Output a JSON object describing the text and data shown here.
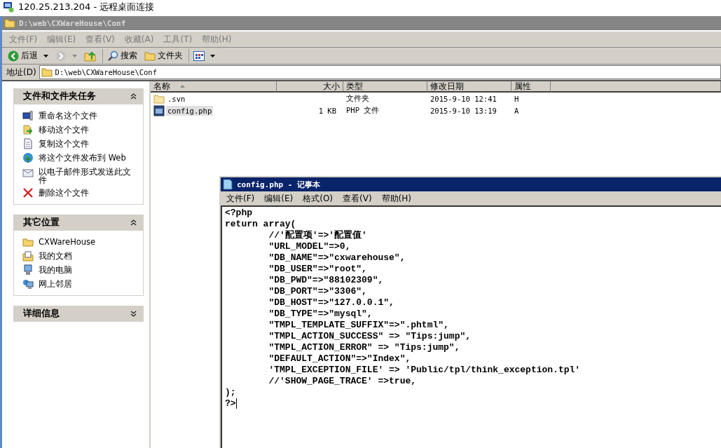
{
  "rdp_title": "120.25.213.204 - 远程桌面连接",
  "explorer": {
    "title": "D:\\web\\CXWareHouse\\Conf",
    "active": false,
    "menu": [
      "文件(F)",
      "编辑(E)",
      "查看(V)",
      "收藏(A)",
      "工具(T)",
      "帮助(H)"
    ],
    "toolbar": [
      {
        "kind": "back",
        "label": "后退",
        "disabled": false
      },
      {
        "kind": "forward",
        "disabled": true
      },
      {
        "kind": "up",
        "disabled": false
      },
      {
        "kind": "search",
        "label": "搜索",
        "disabled": false
      },
      {
        "kind": "folders",
        "label": "文件夹",
        "disabled": false
      },
      {
        "kind": "views",
        "disabled": false
      }
    ],
    "address_label": "地址(D)",
    "address": "D:\\web\\CXWareHouse\\Conf",
    "panels": [
      {
        "title": "文件和文件夹任务",
        "expanded": true,
        "items": [
          "重命名这个文件",
          "移动这个文件",
          "复制这个文件",
          "将这个文件发布到 Web",
          "以电子邮件形式发送此文件",
          "删除这个文件"
        ]
      },
      {
        "title": "其它位置",
        "expanded": true,
        "items": [
          "CXWareHouse",
          "我的文档",
          "我的电脑",
          "网上邻居"
        ]
      },
      {
        "title": "详细信息",
        "expanded": false
      }
    ],
    "columns": [
      "名称",
      "大小",
      "类型",
      "修改日期",
      "属性"
    ],
    "files": [
      {
        "kind": "folder",
        "name": ".svn",
        "type": "文件夹",
        "modified": "2015-9-10 12:41",
        "attr": "H",
        "selected": false
      },
      {
        "kind": "php",
        "name": "config.php",
        "size": "1 KB",
        "type": "PHP 文件",
        "modified": "2015-9-10 13:19",
        "attr": "A",
        "selected": true
      }
    ]
  },
  "notepad": {
    "title": "config.php - 记事本",
    "active": true,
    "menu": [
      "文件(F)",
      "编辑(E)",
      "格式(O)",
      "查看(V)",
      "帮助(H)"
    ],
    "lines": [
      "<?php",
      "return array(",
      "\t//'配置项'=>'配置值'",
      "\t\"URL_MODEL\"=>0,",
      "\t\"DB_NAME\"=>\"cxwarehouse\",",
      "\t\"DB_USER\"=>\"root\",",
      "\t\"DB_PWD\"=>\"88102309\",",
      "\t\"DB_PORT\"=>\"3306\",",
      "\t\"DB_HOST\"=>\"127.0.0.1\",",
      "\t\"DB_TYPE\"=>\"mysql\",",
      "\t\"TMPL_TEMPLATE_SUFFIX\"=>\".phtml\",",
      "\t\"TMPL_ACTION_SUCCESS\" => \"Tips:jump\",",
      "\t\"TMPL_ACTION_ERROR\" => \"Tips:jump\",",
      "\t\"DEFAULT_ACTION\"=>\"Index\",",
      "\t'TMPL_EXCEPTION_FILE' => 'Public/tpl/think_exception.tpl'",
      "\t//'SHOW_PAGE_TRACE' =>true,",
      ");",
      "?>"
    ]
  }
}
